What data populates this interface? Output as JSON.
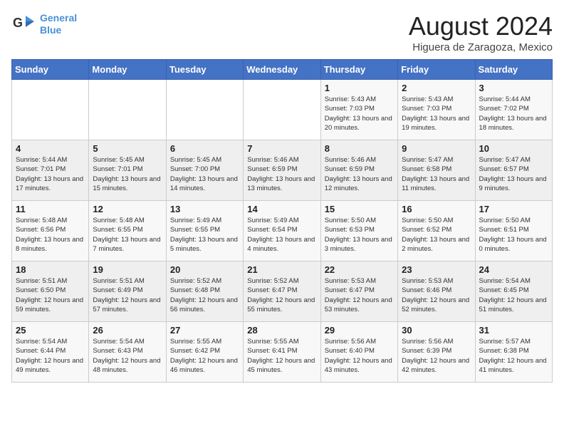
{
  "logo": {
    "line1": "General",
    "line2": "Blue"
  },
  "title": "August 2024",
  "subtitle": "Higuera de Zaragoza, Mexico",
  "days_of_week": [
    "Sunday",
    "Monday",
    "Tuesday",
    "Wednesday",
    "Thursday",
    "Friday",
    "Saturday"
  ],
  "weeks": [
    [
      {
        "day": "",
        "info": ""
      },
      {
        "day": "",
        "info": ""
      },
      {
        "day": "",
        "info": ""
      },
      {
        "day": "",
        "info": ""
      },
      {
        "day": "1",
        "info": "Sunrise: 5:43 AM\nSunset: 7:03 PM\nDaylight: 13 hours\nand 20 minutes."
      },
      {
        "day": "2",
        "info": "Sunrise: 5:43 AM\nSunset: 7:03 PM\nDaylight: 13 hours\nand 19 minutes."
      },
      {
        "day": "3",
        "info": "Sunrise: 5:44 AM\nSunset: 7:02 PM\nDaylight: 13 hours\nand 18 minutes."
      }
    ],
    [
      {
        "day": "4",
        "info": "Sunrise: 5:44 AM\nSunset: 7:01 PM\nDaylight: 13 hours\nand 17 minutes."
      },
      {
        "day": "5",
        "info": "Sunrise: 5:45 AM\nSunset: 7:01 PM\nDaylight: 13 hours\nand 15 minutes."
      },
      {
        "day": "6",
        "info": "Sunrise: 5:45 AM\nSunset: 7:00 PM\nDaylight: 13 hours\nand 14 minutes."
      },
      {
        "day": "7",
        "info": "Sunrise: 5:46 AM\nSunset: 6:59 PM\nDaylight: 13 hours\nand 13 minutes."
      },
      {
        "day": "8",
        "info": "Sunrise: 5:46 AM\nSunset: 6:59 PM\nDaylight: 13 hours\nand 12 minutes."
      },
      {
        "day": "9",
        "info": "Sunrise: 5:47 AM\nSunset: 6:58 PM\nDaylight: 13 hours\nand 11 minutes."
      },
      {
        "day": "10",
        "info": "Sunrise: 5:47 AM\nSunset: 6:57 PM\nDaylight: 13 hours\nand 9 minutes."
      }
    ],
    [
      {
        "day": "11",
        "info": "Sunrise: 5:48 AM\nSunset: 6:56 PM\nDaylight: 13 hours\nand 8 minutes."
      },
      {
        "day": "12",
        "info": "Sunrise: 5:48 AM\nSunset: 6:55 PM\nDaylight: 13 hours\nand 7 minutes."
      },
      {
        "day": "13",
        "info": "Sunrise: 5:49 AM\nSunset: 6:55 PM\nDaylight: 13 hours\nand 5 minutes."
      },
      {
        "day": "14",
        "info": "Sunrise: 5:49 AM\nSunset: 6:54 PM\nDaylight: 13 hours\nand 4 minutes."
      },
      {
        "day": "15",
        "info": "Sunrise: 5:50 AM\nSunset: 6:53 PM\nDaylight: 13 hours\nand 3 minutes."
      },
      {
        "day": "16",
        "info": "Sunrise: 5:50 AM\nSunset: 6:52 PM\nDaylight: 13 hours\nand 2 minutes."
      },
      {
        "day": "17",
        "info": "Sunrise: 5:50 AM\nSunset: 6:51 PM\nDaylight: 13 hours\nand 0 minutes."
      }
    ],
    [
      {
        "day": "18",
        "info": "Sunrise: 5:51 AM\nSunset: 6:50 PM\nDaylight: 12 hours\nand 59 minutes."
      },
      {
        "day": "19",
        "info": "Sunrise: 5:51 AM\nSunset: 6:49 PM\nDaylight: 12 hours\nand 57 minutes."
      },
      {
        "day": "20",
        "info": "Sunrise: 5:52 AM\nSunset: 6:48 PM\nDaylight: 12 hours\nand 56 minutes."
      },
      {
        "day": "21",
        "info": "Sunrise: 5:52 AM\nSunset: 6:47 PM\nDaylight: 12 hours\nand 55 minutes."
      },
      {
        "day": "22",
        "info": "Sunrise: 5:53 AM\nSunset: 6:47 PM\nDaylight: 12 hours\nand 53 minutes."
      },
      {
        "day": "23",
        "info": "Sunrise: 5:53 AM\nSunset: 6:46 PM\nDaylight: 12 hours\nand 52 minutes."
      },
      {
        "day": "24",
        "info": "Sunrise: 5:54 AM\nSunset: 6:45 PM\nDaylight: 12 hours\nand 51 minutes."
      }
    ],
    [
      {
        "day": "25",
        "info": "Sunrise: 5:54 AM\nSunset: 6:44 PM\nDaylight: 12 hours\nand 49 minutes."
      },
      {
        "day": "26",
        "info": "Sunrise: 5:54 AM\nSunset: 6:43 PM\nDaylight: 12 hours\nand 48 minutes."
      },
      {
        "day": "27",
        "info": "Sunrise: 5:55 AM\nSunset: 6:42 PM\nDaylight: 12 hours\nand 46 minutes."
      },
      {
        "day": "28",
        "info": "Sunrise: 5:55 AM\nSunset: 6:41 PM\nDaylight: 12 hours\nand 45 minutes."
      },
      {
        "day": "29",
        "info": "Sunrise: 5:56 AM\nSunset: 6:40 PM\nDaylight: 12 hours\nand 43 minutes."
      },
      {
        "day": "30",
        "info": "Sunrise: 5:56 AM\nSunset: 6:39 PM\nDaylight: 12 hours\nand 42 minutes."
      },
      {
        "day": "31",
        "info": "Sunrise: 5:57 AM\nSunset: 6:38 PM\nDaylight: 12 hours\nand 41 minutes."
      }
    ]
  ]
}
